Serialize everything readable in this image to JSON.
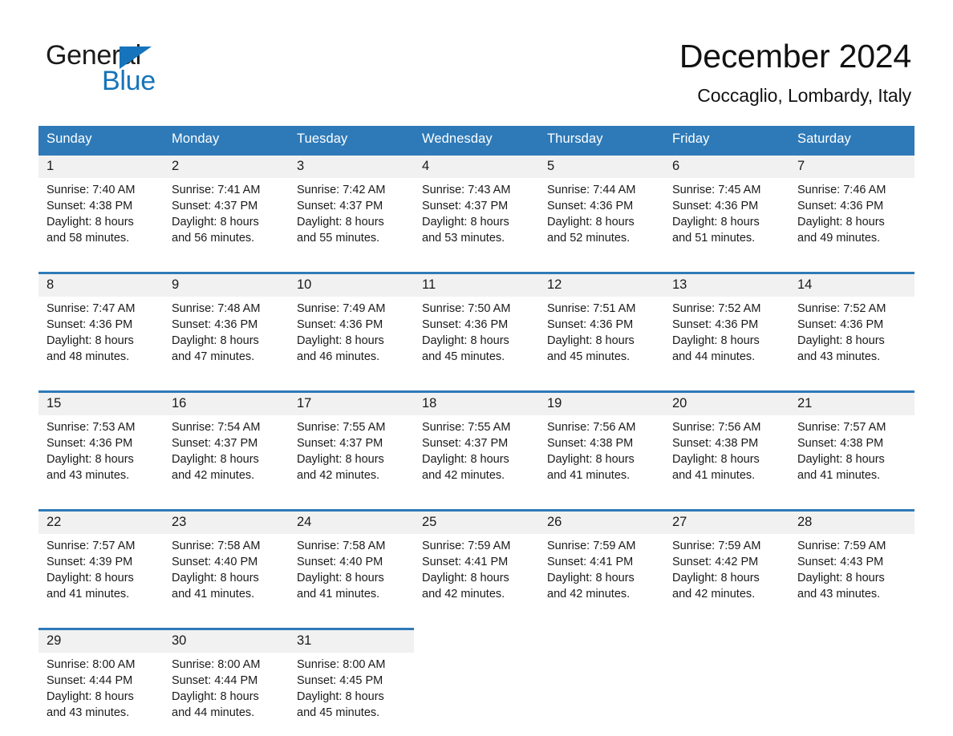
{
  "brand": {
    "name_part1": "General",
    "name_part2": "Blue",
    "triangle_icon": "triangle-logo-icon",
    "accent_color": "#1574bb"
  },
  "header": {
    "month_title": "December 2024",
    "location": "Coccaglio, Lombardy, Italy",
    "header_bar_color": "#2e7ab8",
    "date_band_color": "#f1f1f1"
  },
  "weekday_headers": [
    "Sunday",
    "Monday",
    "Tuesday",
    "Wednesday",
    "Thursday",
    "Friday",
    "Saturday"
  ],
  "labels": {
    "sunrise_prefix": "Sunrise:",
    "sunset_prefix": "Sunset:",
    "daylight_prefix": "Daylight:"
  },
  "weeks": [
    {
      "days": [
        {
          "date": "1",
          "sunrise": "Sunrise: 7:40 AM",
          "sunset": "Sunset: 4:38 PM",
          "daylight_line1": "Daylight: 8 hours",
          "daylight_line2": "and 58 minutes."
        },
        {
          "date": "2",
          "sunrise": "Sunrise: 7:41 AM",
          "sunset": "Sunset: 4:37 PM",
          "daylight_line1": "Daylight: 8 hours",
          "daylight_line2": "and 56 minutes."
        },
        {
          "date": "3",
          "sunrise": "Sunrise: 7:42 AM",
          "sunset": "Sunset: 4:37 PM",
          "daylight_line1": "Daylight: 8 hours",
          "daylight_line2": "and 55 minutes."
        },
        {
          "date": "4",
          "sunrise": "Sunrise: 7:43 AM",
          "sunset": "Sunset: 4:37 PM",
          "daylight_line1": "Daylight: 8 hours",
          "daylight_line2": "and 53 minutes."
        },
        {
          "date": "5",
          "sunrise": "Sunrise: 7:44 AM",
          "sunset": "Sunset: 4:36 PM",
          "daylight_line1": "Daylight: 8 hours",
          "daylight_line2": "and 52 minutes."
        },
        {
          "date": "6",
          "sunrise": "Sunrise: 7:45 AM",
          "sunset": "Sunset: 4:36 PM",
          "daylight_line1": "Daylight: 8 hours",
          "daylight_line2": "and 51 minutes."
        },
        {
          "date": "7",
          "sunrise": "Sunrise: 7:46 AM",
          "sunset": "Sunset: 4:36 PM",
          "daylight_line1": "Daylight: 8 hours",
          "daylight_line2": "and 49 minutes."
        }
      ]
    },
    {
      "days": [
        {
          "date": "8",
          "sunrise": "Sunrise: 7:47 AM",
          "sunset": "Sunset: 4:36 PM",
          "daylight_line1": "Daylight: 8 hours",
          "daylight_line2": "and 48 minutes."
        },
        {
          "date": "9",
          "sunrise": "Sunrise: 7:48 AM",
          "sunset": "Sunset: 4:36 PM",
          "daylight_line1": "Daylight: 8 hours",
          "daylight_line2": "and 47 minutes."
        },
        {
          "date": "10",
          "sunrise": "Sunrise: 7:49 AM",
          "sunset": "Sunset: 4:36 PM",
          "daylight_line1": "Daylight: 8 hours",
          "daylight_line2": "and 46 minutes."
        },
        {
          "date": "11",
          "sunrise": "Sunrise: 7:50 AM",
          "sunset": "Sunset: 4:36 PM",
          "daylight_line1": "Daylight: 8 hours",
          "daylight_line2": "and 45 minutes."
        },
        {
          "date": "12",
          "sunrise": "Sunrise: 7:51 AM",
          "sunset": "Sunset: 4:36 PM",
          "daylight_line1": "Daylight: 8 hours",
          "daylight_line2": "and 45 minutes."
        },
        {
          "date": "13",
          "sunrise": "Sunrise: 7:52 AM",
          "sunset": "Sunset: 4:36 PM",
          "daylight_line1": "Daylight: 8 hours",
          "daylight_line2": "and 44 minutes."
        },
        {
          "date": "14",
          "sunrise": "Sunrise: 7:52 AM",
          "sunset": "Sunset: 4:36 PM",
          "daylight_line1": "Daylight: 8 hours",
          "daylight_line2": "and 43 minutes."
        }
      ]
    },
    {
      "days": [
        {
          "date": "15",
          "sunrise": "Sunrise: 7:53 AM",
          "sunset": "Sunset: 4:36 PM",
          "daylight_line1": "Daylight: 8 hours",
          "daylight_line2": "and 43 minutes."
        },
        {
          "date": "16",
          "sunrise": "Sunrise: 7:54 AM",
          "sunset": "Sunset: 4:37 PM",
          "daylight_line1": "Daylight: 8 hours",
          "daylight_line2": "and 42 minutes."
        },
        {
          "date": "17",
          "sunrise": "Sunrise: 7:55 AM",
          "sunset": "Sunset: 4:37 PM",
          "daylight_line1": "Daylight: 8 hours",
          "daylight_line2": "and 42 minutes."
        },
        {
          "date": "18",
          "sunrise": "Sunrise: 7:55 AM",
          "sunset": "Sunset: 4:37 PM",
          "daylight_line1": "Daylight: 8 hours",
          "daylight_line2": "and 42 minutes."
        },
        {
          "date": "19",
          "sunrise": "Sunrise: 7:56 AM",
          "sunset": "Sunset: 4:38 PM",
          "daylight_line1": "Daylight: 8 hours",
          "daylight_line2": "and 41 minutes."
        },
        {
          "date": "20",
          "sunrise": "Sunrise: 7:56 AM",
          "sunset": "Sunset: 4:38 PM",
          "daylight_line1": "Daylight: 8 hours",
          "daylight_line2": "and 41 minutes."
        },
        {
          "date": "21",
          "sunrise": "Sunrise: 7:57 AM",
          "sunset": "Sunset: 4:38 PM",
          "daylight_line1": "Daylight: 8 hours",
          "daylight_line2": "and 41 minutes."
        }
      ]
    },
    {
      "days": [
        {
          "date": "22",
          "sunrise": "Sunrise: 7:57 AM",
          "sunset": "Sunset: 4:39 PM",
          "daylight_line1": "Daylight: 8 hours",
          "daylight_line2": "and 41 minutes."
        },
        {
          "date": "23",
          "sunrise": "Sunrise: 7:58 AM",
          "sunset": "Sunset: 4:40 PM",
          "daylight_line1": "Daylight: 8 hours",
          "daylight_line2": "and 41 minutes."
        },
        {
          "date": "24",
          "sunrise": "Sunrise: 7:58 AM",
          "sunset": "Sunset: 4:40 PM",
          "daylight_line1": "Daylight: 8 hours",
          "daylight_line2": "and 41 minutes."
        },
        {
          "date": "25",
          "sunrise": "Sunrise: 7:59 AM",
          "sunset": "Sunset: 4:41 PM",
          "daylight_line1": "Daylight: 8 hours",
          "daylight_line2": "and 42 minutes."
        },
        {
          "date": "26",
          "sunrise": "Sunrise: 7:59 AM",
          "sunset": "Sunset: 4:41 PM",
          "daylight_line1": "Daylight: 8 hours",
          "daylight_line2": "and 42 minutes."
        },
        {
          "date": "27",
          "sunrise": "Sunrise: 7:59 AM",
          "sunset": "Sunset: 4:42 PM",
          "daylight_line1": "Daylight: 8 hours",
          "daylight_line2": "and 42 minutes."
        },
        {
          "date": "28",
          "sunrise": "Sunrise: 7:59 AM",
          "sunset": "Sunset: 4:43 PM",
          "daylight_line1": "Daylight: 8 hours",
          "daylight_line2": "and 43 minutes."
        }
      ]
    },
    {
      "days": [
        {
          "date": "29",
          "sunrise": "Sunrise: 8:00 AM",
          "sunset": "Sunset: 4:44 PM",
          "daylight_line1": "Daylight: 8 hours",
          "daylight_line2": "and 43 minutes."
        },
        {
          "date": "30",
          "sunrise": "Sunrise: 8:00 AM",
          "sunset": "Sunset: 4:44 PM",
          "daylight_line1": "Daylight: 8 hours",
          "daylight_line2": "and 44 minutes."
        },
        {
          "date": "31",
          "sunrise": "Sunrise: 8:00 AM",
          "sunset": "Sunset: 4:45 PM",
          "daylight_line1": "Daylight: 8 hours",
          "daylight_line2": "and 45 minutes."
        },
        {
          "date": "",
          "sunrise": "",
          "sunset": "",
          "daylight_line1": "",
          "daylight_line2": ""
        },
        {
          "date": "",
          "sunrise": "",
          "sunset": "",
          "daylight_line1": "",
          "daylight_line2": ""
        },
        {
          "date": "",
          "sunrise": "",
          "sunset": "",
          "daylight_line1": "",
          "daylight_line2": ""
        },
        {
          "date": "",
          "sunrise": "",
          "sunset": "",
          "daylight_line1": "",
          "daylight_line2": ""
        }
      ]
    }
  ]
}
